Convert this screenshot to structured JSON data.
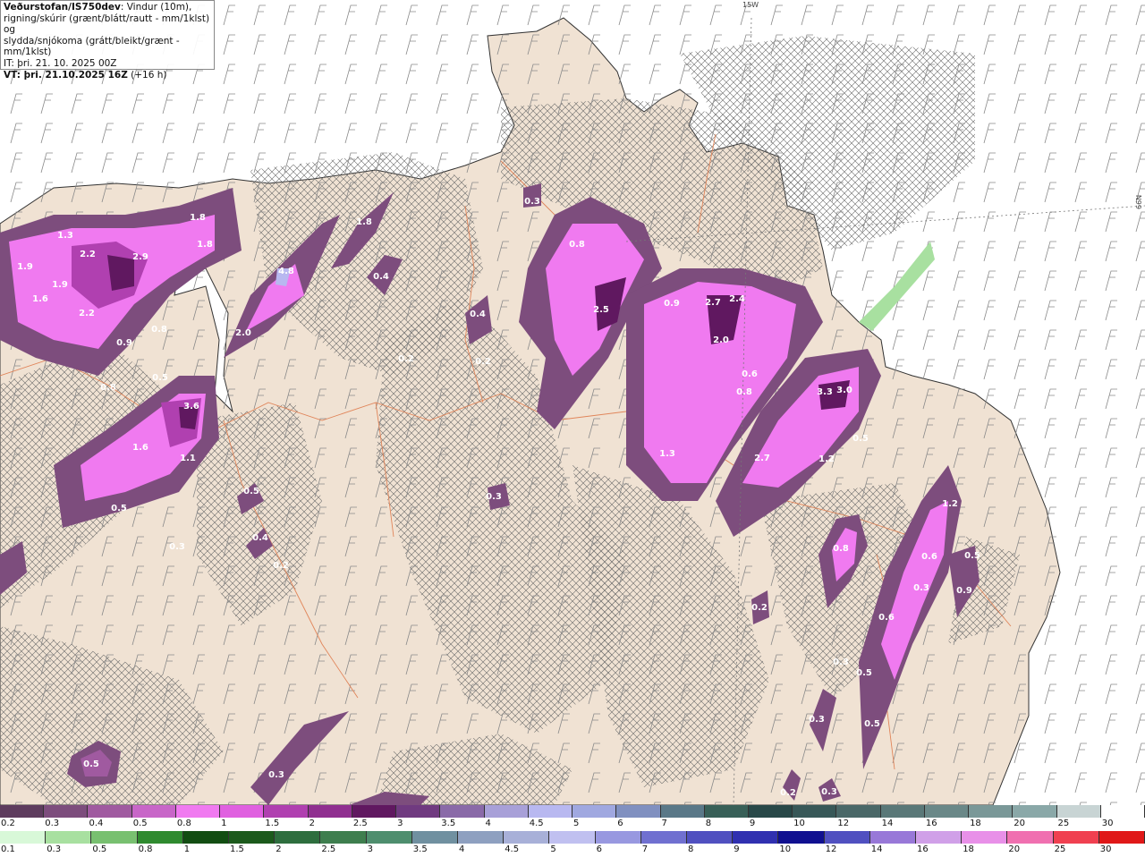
{
  "legend": {
    "title_bold": "Veðurstofan/IS750dev",
    "title_rest": ": Vindur (10m),",
    "line2": "rigning/skúrir (grænt/blátt/rautt - mm/1klst) og",
    "line3": "slydda/snjókoma (grátt/bleikt/grænt - mm/1klst)",
    "it": "IT: þri. 21. 10. 2025 00Z",
    "vt_bold": "VT: þri. 21.10.2025 16Z",
    "vt_rest": " (+16 h)"
  },
  "map": {
    "edge_top": "15W",
    "edge_right": "66N",
    "colors": {
      "sea": "#ffffff",
      "land": "#f0e2d3",
      "hatch": "#6a6a6a",
      "roads": "#e0855a",
      "coast": "#333333"
    },
    "precip_labels": [
      "1.3",
      "2.2",
      "2.9",
      "1.8",
      "1.9",
      "1.8",
      "1.9",
      "1.6",
      "2.2",
      "0.9",
      "0.8",
      "0.8",
      "0.5",
      "3.6",
      "1.6",
      "1.1",
      "0.5",
      "0.3",
      "0.5",
      "0.4",
      "0.2",
      "2.0",
      "4.8",
      "1.8",
      "0.4",
      "0.4",
      "0.2",
      "0.2",
      "0.3",
      "0.8",
      "2.5",
      "0.3",
      "0.9",
      "2.7",
      "2.4",
      "2.0",
      "0.6",
      "0.8",
      "1.3",
      "3.3",
      "3.0",
      "2.7",
      "1.2",
      "0.5",
      "0.8",
      "0.2",
      "1.2",
      "0.6",
      "0.5",
      "0.9",
      "0.6",
      "0.5",
      "0.3",
      "0.5",
      "0.3",
      "0.3",
      "0.2",
      "0.3",
      "0.5",
      "0.3"
    ]
  },
  "scale_snow": {
    "labels": [
      "0.2",
      "0.3",
      "0.4",
      "0.5",
      "0.8",
      "1",
      "1.5",
      "2",
      "2.5",
      "3",
      "3.5",
      "4",
      "4.5",
      "5",
      "6",
      "7",
      "8",
      "9",
      "10",
      "12",
      "14",
      "16",
      "18",
      "20",
      "25",
      "30"
    ],
    "colors": [
      "#5e3c5e",
      "#7d4d7d",
      "#a05aa0",
      "#c866c8",
      "#f07af0",
      "#e060e0",
      "#b040b0",
      "#902f90",
      "#601860",
      "#703a80",
      "#8a6aa8",
      "#a8a0d8",
      "#b8b8f0",
      "#a0a8e0",
      "#8090c0",
      "#5a7888",
      "#386058",
      "#284848",
      "#385858",
      "#4a6868",
      "#5a7878",
      "#6a8888",
      "#7a9898",
      "#8aa8a8",
      "#c8d4d4",
      "#ffffff"
    ]
  },
  "scale_rain": {
    "labels": [
      "0.1",
      "0.3",
      "0.5",
      "0.8",
      "1",
      "1.5",
      "2",
      "2.5",
      "3",
      "3.5",
      "4",
      "4.5",
      "5",
      "6",
      "7",
      "8",
      "9",
      "10",
      "12",
      "14",
      "16",
      "18",
      "20",
      "25",
      "30"
    ],
    "colors": [
      "#d8f8d8",
      "#a8e0a0",
      "#78c070",
      "#2f8a2f",
      "#124d12",
      "#1c5a1c",
      "#2e6e3e",
      "#3e7e4e",
      "#4e8e6e",
      "#7090a0",
      "#8ea0c0",
      "#a8b0d8",
      "#c0c0f0",
      "#9898e0",
      "#7070d0",
      "#5050c0",
      "#3030b0",
      "#101090",
      "#5050c0",
      "#9878d8",
      "#d0a0e8",
      "#e890e8",
      "#f070b0",
      "#f04050",
      "#e01818"
    ]
  }
}
